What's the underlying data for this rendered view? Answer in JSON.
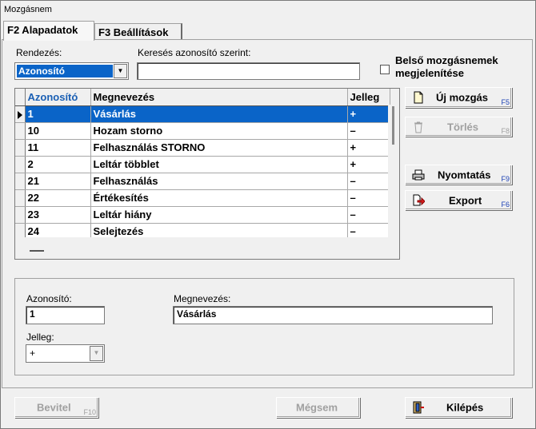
{
  "window": {
    "title": "Mozgásnem"
  },
  "tabs": [
    {
      "label": "F2 Alapadatok",
      "active": true
    },
    {
      "label": "F3 Beállítások",
      "active": false
    }
  ],
  "filters": {
    "sort_label": "Rendezés:",
    "sort_value": "Azonosító",
    "search_label": "Keresés azonosító szerint:",
    "search_value": "",
    "internal_checkbox_label_line1": "Belső mozgásnemek",
    "internal_checkbox_label_line2": "megjelenítése",
    "internal_checked": false
  },
  "grid": {
    "columns": [
      "Azonosító",
      "Megnevezés",
      "Jelleg"
    ],
    "sorted_column": "Azonosító",
    "rows": [
      {
        "id": "1",
        "name": "Vásárlás",
        "type": "+"
      },
      {
        "id": "10",
        "name": "Hozam storno",
        "type": "–"
      },
      {
        "id": "11",
        "name": "Felhasználás STORNO",
        "type": "+"
      },
      {
        "id": "2",
        "name": "Leltár többlet",
        "type": "+"
      },
      {
        "id": "21",
        "name": "Felhasználás",
        "type": "–"
      },
      {
        "id": "22",
        "name": "Értékesítés",
        "type": "–"
      },
      {
        "id": "23",
        "name": "Leltár hiány",
        "type": "–"
      },
      {
        "id": "24",
        "name": "Selejtezés",
        "type": "–"
      }
    ],
    "selected_index": 0
  },
  "side_buttons": {
    "new": {
      "label": "Új mozgás",
      "key": "F5"
    },
    "delete": {
      "label": "Törlés",
      "key": "F8"
    },
    "print": {
      "label": "Nyomtatás",
      "key": "F9"
    },
    "export": {
      "label": "Export",
      "key": "F6"
    }
  },
  "detail": {
    "id_label": "Azonosító:",
    "id_value": "1",
    "name_label": "Megnevezés:",
    "name_value": "Vásárlás",
    "type_label": "Jelleg:",
    "type_value": "+"
  },
  "bottom_buttons": {
    "submit": {
      "label": "Bevitel",
      "key": "F10"
    },
    "cancel": {
      "label": "Mégsem"
    },
    "exit": {
      "label": "Kilépés"
    }
  },
  "colors": {
    "selection": "#0a64c8",
    "sorted_header": "#1a5fb4",
    "hotkey": "#1a3fb4"
  }
}
